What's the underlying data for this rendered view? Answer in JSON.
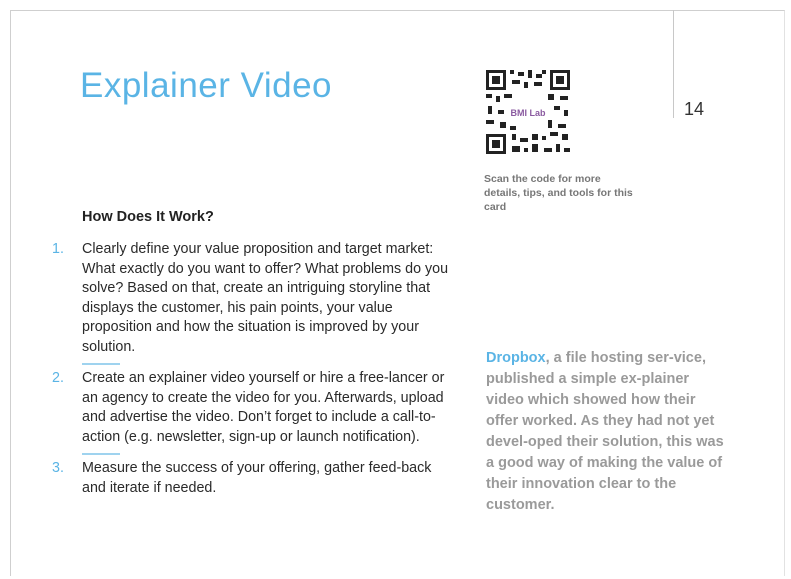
{
  "card": {
    "title": "Explainer Video",
    "page_number": "14",
    "qr_label": "BMI Lab",
    "scan_note": "Scan the code for more details, tips, and tools for this card",
    "section_heading": "How Does It Work?",
    "steps": [
      {
        "number": "1.",
        "text": "Clearly define your value proposition and target market: What exactly do you want to offer? What problems do you solve? Based on that, create an intriguing storyline that displays the customer, his pain points, your value proposition and how the situation is improved by your solution."
      },
      {
        "number": "2.",
        "text": "Create an explainer video yourself or hire a free-lancer or an agency to create the video for you. Afterwards, upload and advertise the video. Don’t forget to include a call-to-action (e.g. newsletter, sign-up or launch notification)."
      },
      {
        "number": "3.",
        "text": "Measure the success of your offering, gather feed-back and iterate if needed."
      }
    ],
    "example": {
      "brand": "Dropbox",
      "text": ", a file hosting ser-vice, published a simple ex-plainer video which showed how their offer worked. As they had not yet devel-oped their solution, this was a good way of making the value of their innovation clear to the customer."
    }
  },
  "colors": {
    "accent": "#5ab4e5",
    "body_text": "#2a2a2a",
    "example_text": "#9a9a9a"
  }
}
